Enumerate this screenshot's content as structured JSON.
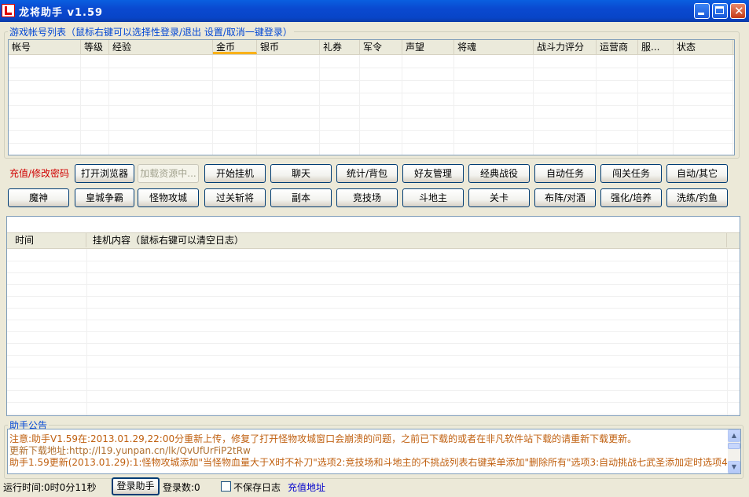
{
  "window": {
    "title": "龙将助手 v1.59"
  },
  "accounts": {
    "group_title": "游戏帐号列表（鼠标右键可以选择性登录/退出 设置/取消一键登录）",
    "columns": [
      "帐号",
      "等级",
      "经验",
      "金币",
      "银币",
      "礼券",
      "军令",
      "声望",
      "将魂",
      "战斗力评分",
      "运营商",
      "服...",
      "状态"
    ],
    "sorted_column": "金币"
  },
  "buttons": {
    "row1": [
      "充值/修改密码",
      "打开浏览器",
      "加载资源中...",
      "开始挂机",
      "聊天",
      "统计/背包",
      "好友管理",
      "经典战役",
      "自动任务",
      "闯关任务",
      "自动/其它"
    ],
    "row2": [
      "魔神",
      "皇城争霸",
      "怪物攻城",
      "过关斩将",
      "副本",
      "竞技场",
      "斗地主",
      "关卡",
      "布阵/对酒",
      "强化/培养",
      "洗练/钓鱼"
    ]
  },
  "log": {
    "columns": [
      "时间",
      "挂机内容（鼠标右键可以清空日志）"
    ]
  },
  "notice": {
    "title": "助手公告",
    "lines": [
      "注意:助手V1.59在:2013.01.29,22:00分重新上传，修复了打开怪物攻城窗口会崩溃的问题，之前已下载的或者在非凡软件站下载的请重新下载更新。",
      "更新下载地址:http://l19.yunpan.cn/lk/QvUfUrFiP2tRw",
      "助手1.59更新(2013.01.29):1:怪物攻城添加\"当怪物血量大于X时不补刀\"选项2:竞技场和斗地主的不挑战列表右键菜单添加\"删除所有\"选项3:自动挑战七武圣添加定时选项4:"
    ]
  },
  "status": {
    "runtime": "运行时间:0时0分11秒",
    "login_button": "登录助手",
    "login_count": "登录数:0",
    "no_save_log": "不保存日志",
    "recharge_link": "充值地址"
  }
}
